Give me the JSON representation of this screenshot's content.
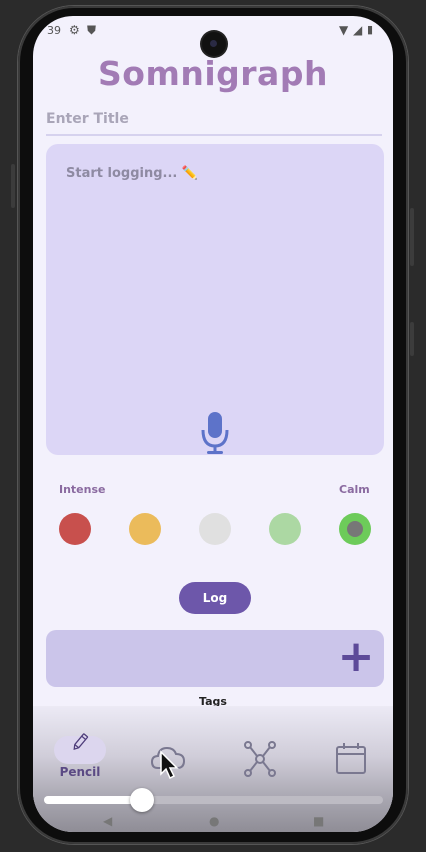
{
  "status_bar": {
    "time": "39"
  },
  "app": {
    "title": "Somnigraph"
  },
  "entry": {
    "title_placeholder": "Enter Title",
    "log_placeholder": "Start logging... ✏️"
  },
  "mood": {
    "left_label": "Intense",
    "right_label": "Calm",
    "selected_index": 4,
    "colors": [
      "#c8504d",
      "#ebbb5b",
      "#e0e0e0",
      "#acd8a3",
      "#6dcb5a"
    ]
  },
  "actions": {
    "log_label": "Log"
  },
  "tags": {
    "label": "Tags",
    "add_glyph": "+"
  },
  "nav": {
    "items": [
      {
        "icon": "pencil-icon",
        "label": "Pencil",
        "active": true
      },
      {
        "icon": "cloud-icon"
      },
      {
        "icon": "network-icon"
      },
      {
        "icon": "calendar-icon"
      }
    ]
  },
  "media_slider": {
    "progress": 0.29
  }
}
